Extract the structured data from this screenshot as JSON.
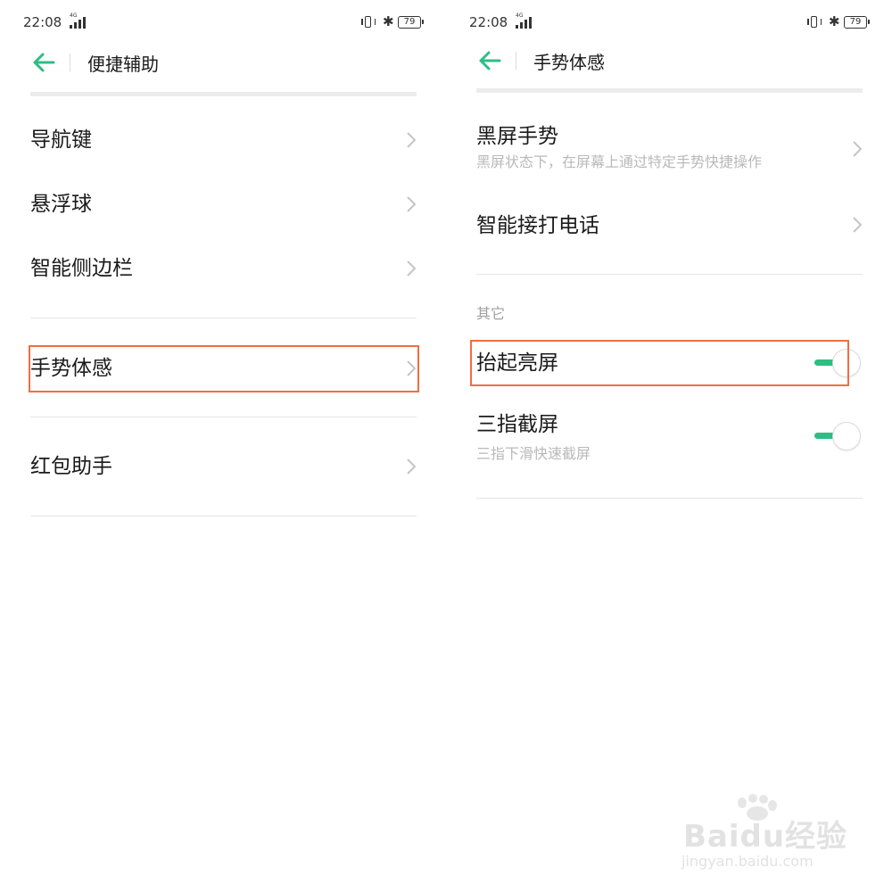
{
  "left": {
    "status": {
      "time": "22:08",
      "network": "4G",
      "battery": "79"
    },
    "header": {
      "title": "便捷辅助"
    },
    "items": [
      {
        "label": "导航键"
      },
      {
        "label": "悬浮球"
      },
      {
        "label": "智能侧边栏"
      },
      {
        "label": "手势体感",
        "highlighted": true
      },
      {
        "label": "红包助手"
      }
    ]
  },
  "right": {
    "status": {
      "time": "22:08",
      "network": "4G",
      "battery": "79"
    },
    "header": {
      "title": "手势体感"
    },
    "items": [
      {
        "label": "黑屏手势",
        "subtitle": "黑屏状态下，在屏幕上通过特定手势快捷操作"
      },
      {
        "label": "智能接打电话"
      }
    ],
    "section_title": "其它",
    "toggles": [
      {
        "label": "抬起亮屏",
        "on": true,
        "highlighted": true
      },
      {
        "label": "三指截屏",
        "subtitle": "三指下滑快速截屏",
        "on": true
      }
    ]
  },
  "watermark": {
    "brand": "Baidu经验",
    "url": "jingyan.baidu.com"
  },
  "colors": {
    "accent": "#2fbd84",
    "highlight": "#ef6e43",
    "divider": "#e6e6e6",
    "subtitle": "#b9b9b9"
  },
  "icons": {
    "back": "arrow-left-icon",
    "chevron": "chevron-right-icon",
    "bluetooth": "bluetooth-icon",
    "vibrate": "vibrate-icon",
    "signal": "signal-icon",
    "battery": "battery-icon"
  }
}
